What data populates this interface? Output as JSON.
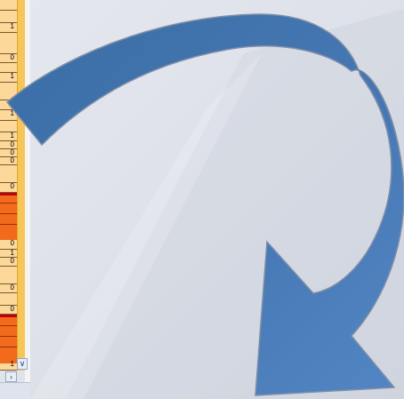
{
  "spreadsheet": {
    "cells": [
      "1",
      "0",
      "1",
      "1",
      "1",
      "1",
      "0",
      "0",
      "0",
      "0",
      "0",
      "1",
      "0",
      "0",
      "0",
      "1"
    ]
  },
  "scrollbar": {
    "down_arrow": "∨",
    "right_arrow": "›"
  },
  "slide": {
    "arrow_shape": "curved-arrow-icon",
    "arrow_colors": {
      "dark": "#3a6ea5",
      "light": "#4f81bd",
      "outline": "#7f8fa8"
    },
    "background_color": "#dfe3ea"
  }
}
